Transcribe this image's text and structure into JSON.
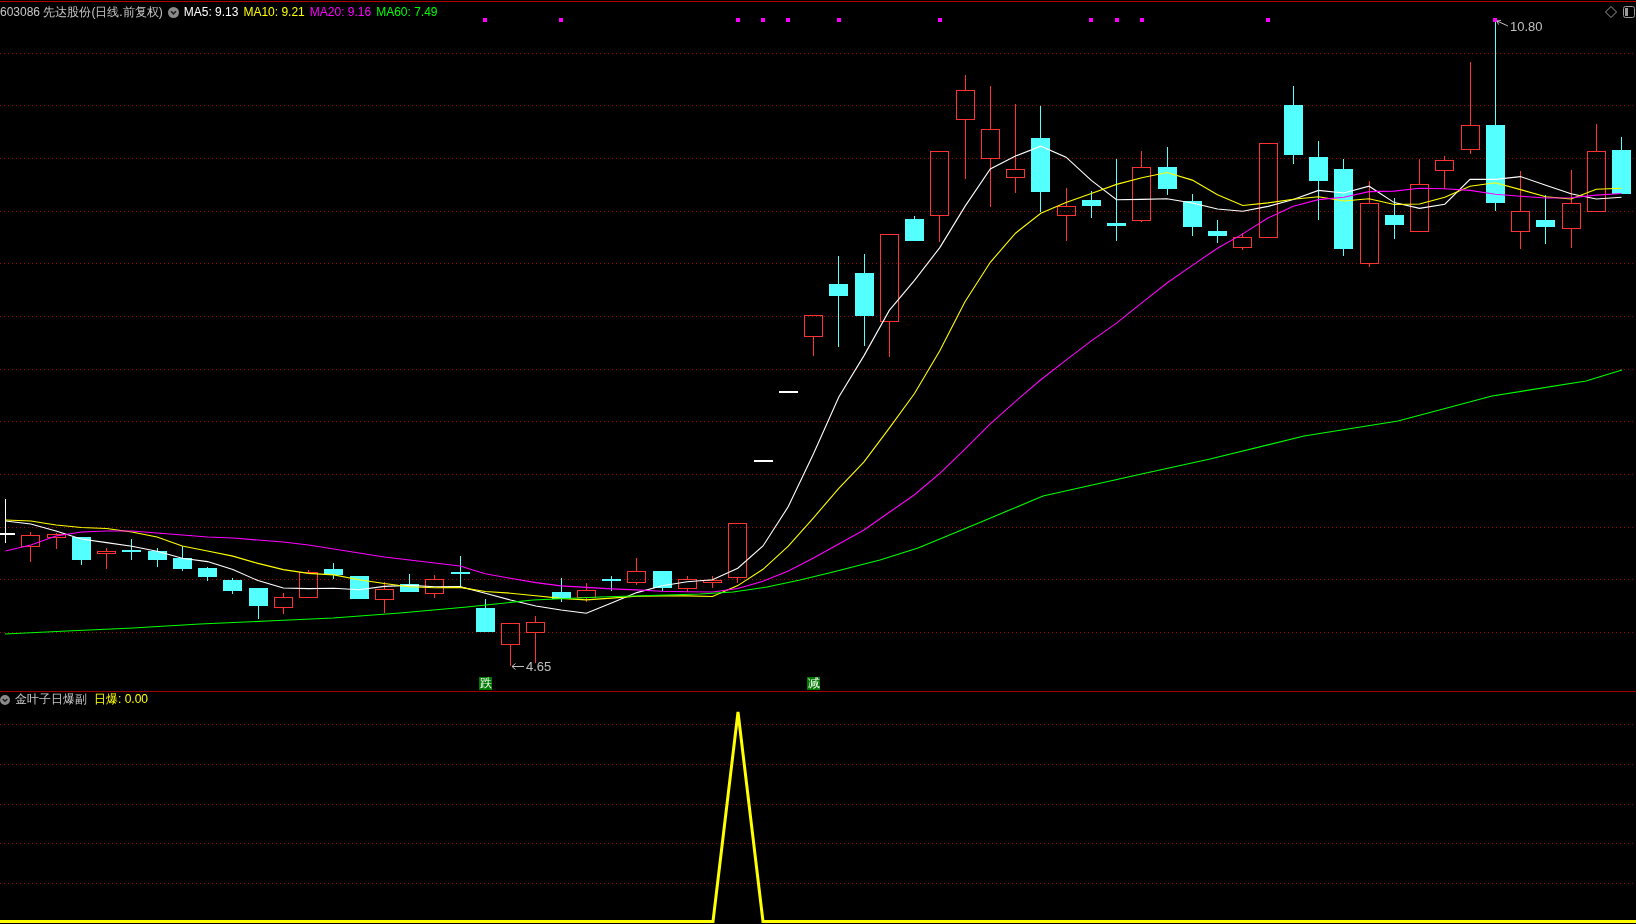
{
  "header": {
    "title": "603086 先达股份(日线.前复权)",
    "ma_legend": [
      {
        "label": "MA5: 9.13",
        "color": "#ffffff"
      },
      {
        "label": "MA10: 9.21",
        "color": "#ffff00"
      },
      {
        "label": "MA20: 9.16",
        "color": "#ff00ff"
      },
      {
        "label": "MA60: 7.49",
        "color": "#00ff00"
      }
    ]
  },
  "price_chart": {
    "high_label": "10.80",
    "low_label": "4.65",
    "signals": [
      {
        "label": "跌"
      },
      {
        "label": "减"
      }
    ]
  },
  "indicator_panel": {
    "name": "金叶子日爆副",
    "value_label": "日爆: 0.00"
  }
}
